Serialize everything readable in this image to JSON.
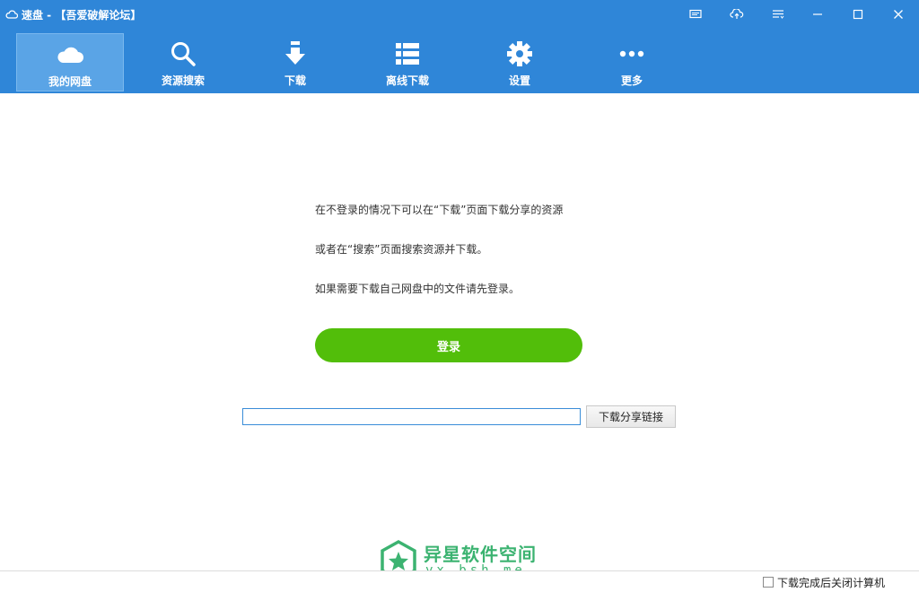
{
  "window": {
    "title": "速盘 - 【吾爱破解论坛】",
    "controls": [
      "display-icon",
      "cloud-upload-icon",
      "menu-list-icon",
      "minimize-icon",
      "maximize-icon",
      "close-icon"
    ]
  },
  "nav": {
    "items": [
      {
        "label": "我的网盘",
        "icon": "cloud-icon",
        "active": true
      },
      {
        "label": "资源搜索",
        "icon": "search-icon",
        "active": false
      },
      {
        "label": "下载",
        "icon": "download-arrow-icon",
        "active": false
      },
      {
        "label": "离线下载",
        "icon": "list-icon",
        "active": false
      },
      {
        "label": "设置",
        "icon": "gear-icon",
        "active": false
      },
      {
        "label": "更多",
        "icon": "more-dots-icon",
        "active": false
      }
    ]
  },
  "main": {
    "messages": [
      "在不登录的情况下可以在“下载”页面下载分享的资源",
      "或者在“搜索”页面搜索资源并下载。",
      "如果需要下载自己网盘中的文件请先登录。"
    ],
    "login_label": "登录",
    "share_link_input": {
      "value": "",
      "placeholder": ""
    },
    "share_button_label": "下载分享链接"
  },
  "watermark": {
    "title": "异星软件空间",
    "url": "yx.bsh.me",
    "icon": "star-shield-icon"
  },
  "statusbar": {
    "shutdown_label": "下载完成后关闭计算机",
    "shutdown_checked": false
  },
  "colors": {
    "topbar": "#2f86d8",
    "active_nav": "#5aa4e6",
    "login": "#52be0a",
    "watermark": "#3cb371"
  }
}
